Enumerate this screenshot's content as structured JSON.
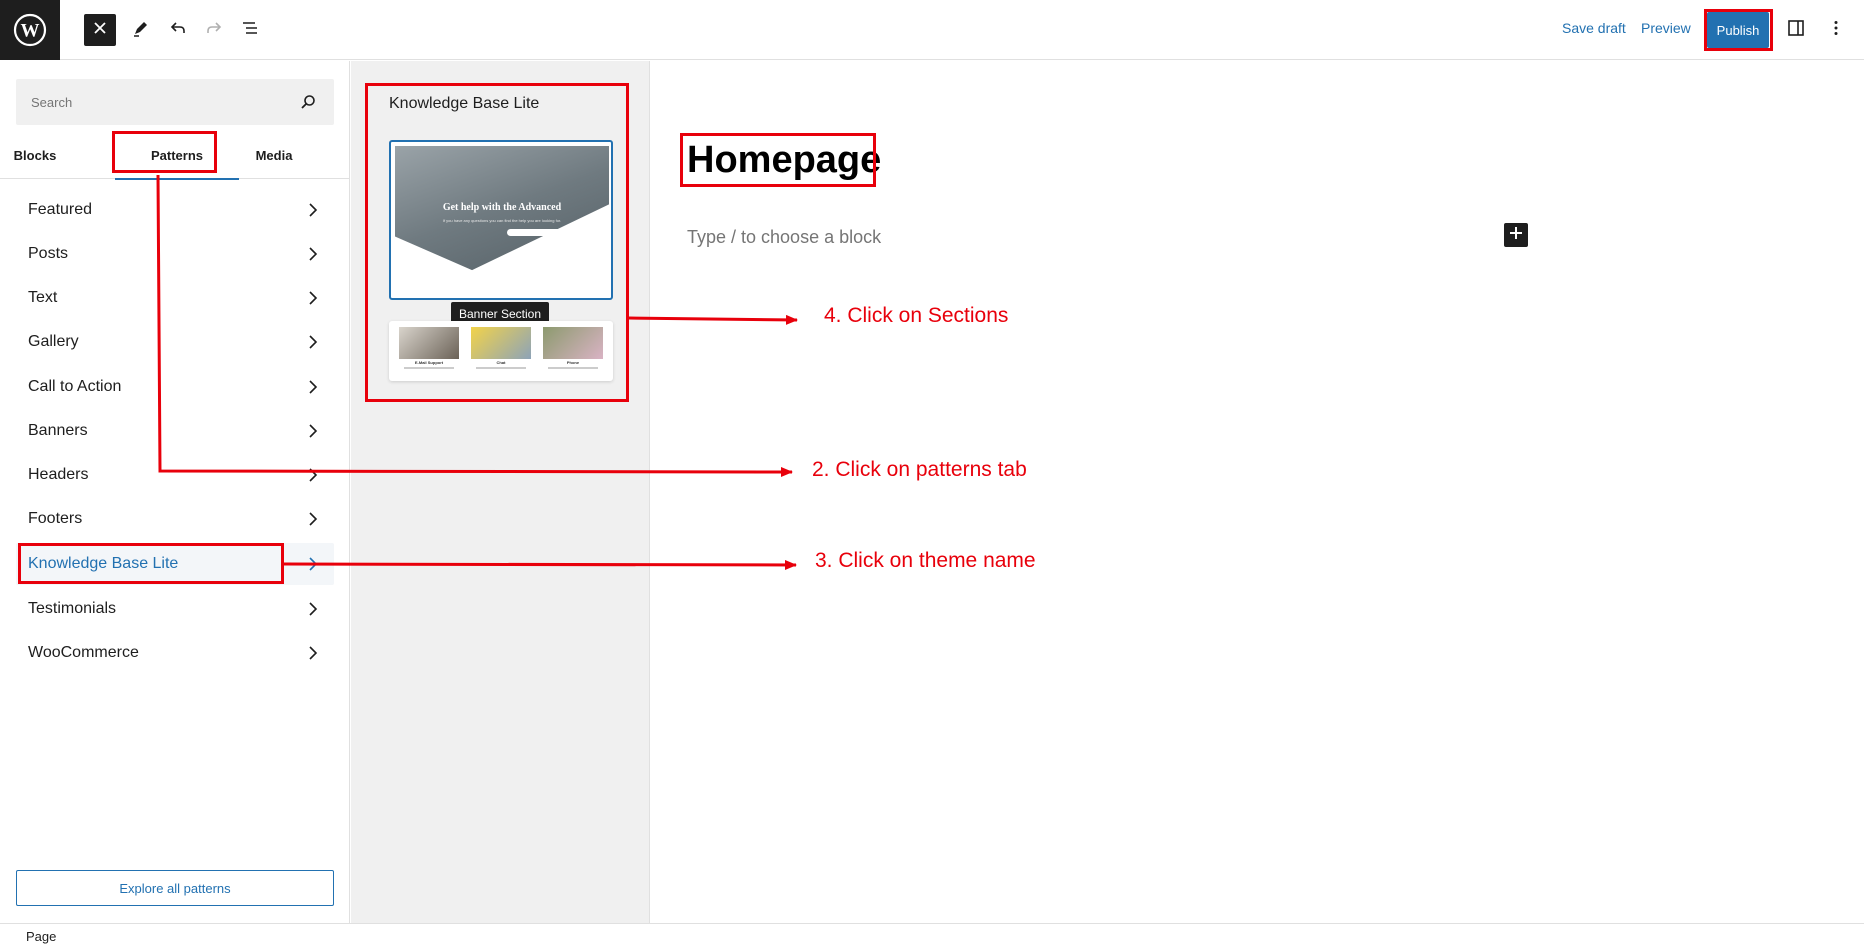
{
  "toolbar": {
    "save_draft": "Save draft",
    "preview": "Preview",
    "publish": "Publish"
  },
  "inserter": {
    "search_placeholder": "Search",
    "tabs": [
      "Blocks",
      "Patterns",
      "Media"
    ],
    "active_tab": "Patterns",
    "categories": [
      {
        "label": "Featured"
      },
      {
        "label": "Posts"
      },
      {
        "label": "Text"
      },
      {
        "label": "Gallery"
      },
      {
        "label": "Call to Action"
      },
      {
        "label": "Banners"
      },
      {
        "label": "Headers"
      },
      {
        "label": "Footers"
      },
      {
        "label": "Knowledge Base Lite",
        "selected": true
      },
      {
        "label": "Testimonials"
      },
      {
        "label": "WooCommerce"
      }
    ],
    "explore_label": "Explore all patterns"
  },
  "patterns_panel": {
    "title": "Knowledge Base Lite",
    "banner_heading": "Get help with the Advanced",
    "banner_subtext": "If you have any questions you can find the help you are looking for.",
    "tooltip": "Banner Section",
    "sections": [
      {
        "caption": "E-Mail Support"
      },
      {
        "caption": "Chat"
      },
      {
        "caption": "Phone"
      }
    ]
  },
  "editor": {
    "page_title": "Homepage",
    "placeholder": "Type / to choose a block"
  },
  "status_bar": {
    "label": "Page"
  },
  "annotations": {
    "step2": "2. Click on patterns tab",
    "step3": "3. Click on theme name",
    "step4": "4. Click on Sections"
  },
  "colors": {
    "accent": "#2271b1",
    "annotation": "#e8000b",
    "dark": "#1e1e1e"
  }
}
